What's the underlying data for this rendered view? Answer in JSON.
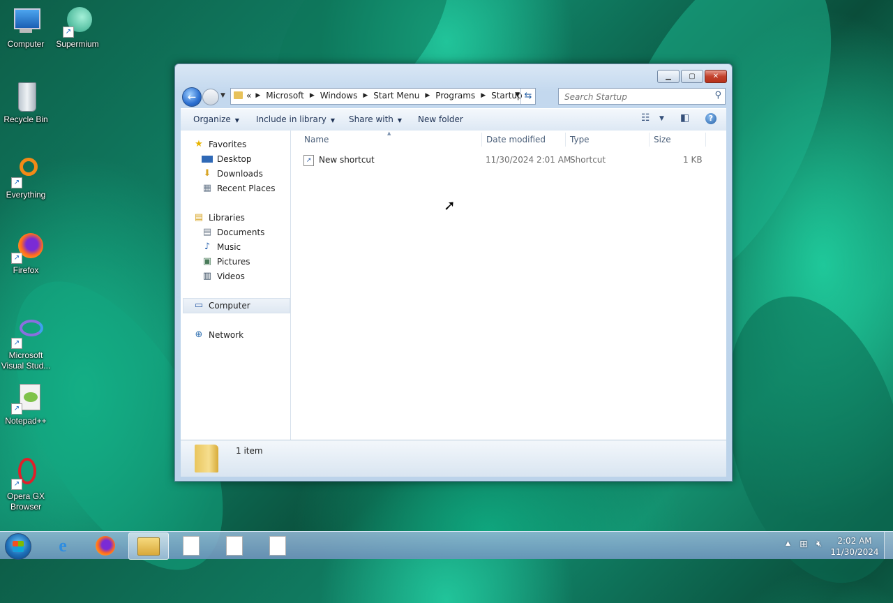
{
  "desktop": {
    "icons": [
      {
        "label": "Computer"
      },
      {
        "label": "Supermium"
      },
      {
        "label": "Recycle Bin"
      },
      {
        "label": "Everything"
      },
      {
        "label": "Firefox"
      },
      {
        "label": "Microsoft Visual Stud..."
      },
      {
        "label": "Notepad++"
      },
      {
        "label": "Opera GX Browser"
      }
    ]
  },
  "window": {
    "address": {
      "overflow": "«",
      "crumbs": [
        "Microsoft",
        "Windows",
        "Start Menu",
        "Programs",
        "Startup"
      ]
    },
    "search": {
      "placeholder": "Search Startup"
    },
    "toolbar": {
      "organize": "Organize",
      "include_in_library": "Include in library",
      "share_with": "Share with",
      "new_folder": "New folder"
    },
    "nav": {
      "favorites": "Favorites",
      "desktop": "Desktop",
      "downloads": "Downloads",
      "recent_places": "Recent Places",
      "libraries": "Libraries",
      "documents": "Documents",
      "music": "Music",
      "pictures": "Pictures",
      "videos": "Videos",
      "computer": "Computer",
      "network": "Network"
    },
    "columns": {
      "name": "Name",
      "date_modified": "Date modified",
      "type": "Type",
      "size": "Size"
    },
    "files": [
      {
        "name": "New shortcut",
        "date_modified": "11/30/2024 2:01 AM",
        "type": "Shortcut",
        "size": "1 KB"
      }
    ],
    "details": {
      "count": "1 item"
    }
  },
  "taskbar": {
    "clock_time": "2:02 AM",
    "clock_date": "11/30/2024"
  }
}
